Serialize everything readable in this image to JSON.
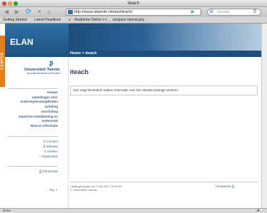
{
  "window": {
    "title": "iteach"
  },
  "toolbar": {
    "url": "http://www.utwente.nl/elan/iteach/",
    "search_placeholder": "Google"
  },
  "bookmarks": [
    "Getting Started",
    "Latest Headlines",
    "Akademia Online s-t...",
    "program operacyjny ..."
  ],
  "site": {
    "side_tab": "CAMPUS",
    "logo": "ELAN",
    "breadcrumb": "Home > iteach"
  },
  "university": {
    "name": "Universiteit Twente",
    "tagline": "de ondernemende universiteit"
  },
  "menu": [
    "nieuws",
    "opleidingen voor onderwijsbevoegdheden",
    "scholing",
    "nascholing",
    "expertise-ontwikkeling en onderzoek",
    "diverse informatie"
  ],
  "utility_links": [
    "Contact",
    "Sitemap",
    "Zoeken",
    "Organisatie"
  ],
  "printversie": "Printversie",
  "top_link": "Top",
  "main": {
    "title": "iteach",
    "notice": "hier volgt binnenkort nadere informatie over het virtuele trainings centrum"
  },
  "footer": {
    "modified": "Laatst gewijzigd op 27-08-2007 16:52:03",
    "copyright": "© Universiteit Twente"
  },
  "status": {
    "text": "Done"
  }
}
